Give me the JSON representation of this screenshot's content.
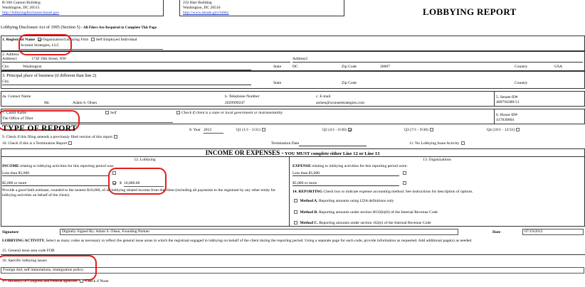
{
  "header": {
    "house_addr1": "B-106 Cannon Building",
    "house_addr2": "Washington, DC 20515",
    "house_link": "http://lobbyingdisclosure.house.gov",
    "senate_addr1": "232 Hart Building",
    "senate_addr2": "Washington, DC 20510",
    "senate_link": "http://www.senate.gov/lobby",
    "report_title": "LOBBYING REPORT"
  },
  "act_line": {
    "title": "Lobbying Disclosure Act of 1995 (Section 5)",
    "note": "- All Filers Are Required to Complete This Page"
  },
  "registrant": {
    "label_num": "1.",
    "label": "Registrant Name",
    "opt1": "Organization/Lobbying Firm",
    "opt2": "Self Employed Individual",
    "name": "Sconset Strategies, LLC"
  },
  "address": {
    "label": "2. Address",
    "addr1_label": "Address1",
    "addr1": "1730 19th Street, NW",
    "addr2_label": "Address2",
    "city_label": "City",
    "city": "Washington",
    "state_label": "State",
    "state": "DC",
    "zip_label": "Zip Code",
    "zip": "20007",
    "country_label": "Country",
    "country": "USA"
  },
  "principal": {
    "label": "3. Principal place of business (if different than line 2)",
    "city_label": "City",
    "state_label": "State",
    "zip_label": "Zip Code",
    "country_label": "Country"
  },
  "contact": {
    "label": "4a. Contact Name",
    "title": "Mr.",
    "name": "Adam S. Olsen",
    "phone_label": "b. Telephone Number",
    "phone": "2029999247",
    "email_label": "c. E-mail",
    "email": "aolsen@sconsetstrategies.com",
    "senate_id_label": "5. Senate ID#",
    "senate_id": "400794388-51"
  },
  "client": {
    "label": "7. Client Name",
    "self_label": "Self",
    "gov_label": "Check if client is a state or local government or instrumentality",
    "name": "The Office of Tibet",
    "house_id_label": "6. House ID#",
    "house_id": "417830004"
  },
  "type_report": {
    "title": "TYPE OF REPORT",
    "year_label": "8. Year",
    "year": "2012",
    "q1": "Q1 (1/1 - 3/31)",
    "q2": "Q2 (4/1 - 6/30)",
    "q3": "Q3 (7/1 - 9/30)",
    "q4": "Q4 (10/1 - 12/31)",
    "line9": "9. Check if this filing amends a previously filed version of this report",
    "line10": "10. Check if this is a Termination Report",
    "termination_label": "Termination Date",
    "line11": "11. No Lobbying Issue Activity"
  },
  "income": {
    "heading": "INCOME OR EXPENSES -",
    "heading_note": "YOU MUST complete either Line 12 or Line 13",
    "l12_title": "12. Lobbying",
    "l13_title": "13. Organizations",
    "income_intro_bold": "INCOME",
    "income_intro": "relating to lobbying activities for this reporting period was:",
    "less_label": "Less than $5,000",
    "more_label": "$5,000 or more",
    "dollar": "$",
    "amount": "10,000.00",
    "estimate_text": "Provide a good faith estimate, rounded to the nearest $10,000, of all lobbying related income from the client (including all payments to the registrant by any other entity for lobbying activities on behalf of the client).",
    "expense_intro_bold": "EXPENSE",
    "expense_intro": "relating to lobbying activities for this reporting period were:",
    "exp_less_label": "Less than $5,000",
    "exp_more_label": "$5,000 or more",
    "line14_bold": "14. REPORTING",
    "line14": "Check box to indicate expense accounting method. See instructions for description of options.",
    "method_a_bold": "Method A.",
    "method_a": "Reporting amounts using LDA definitions only",
    "method_b_bold": "Method B.",
    "method_b": "Reporting amounts under section 6033(b)(8) of the Internal Revenue Code",
    "method_c_bold": "Method C.",
    "method_c": "Reporting amounts under section 162(e) of the Internal Revenue Code"
  },
  "signature": {
    "label": "Signature",
    "value": "Digitally Signed By: Adam S. Olsen, Founding Partner",
    "date_label": "Date",
    "date": "07/19/2012"
  },
  "lobbying_activity": {
    "title": "LOBBYING ACTIVITY.",
    "text": "Select as many codes as necessary to reflect the general issue areas in which the registrant engaged in lobbying on behalf of the client during the reporting period. Using a separate page for each code, provide information as requested. Add additional page(s) as needed.",
    "line15": "15. General issue area code FOR",
    "line16": "16. Specific lobbying issues",
    "issues": "Foreign Aid, self immolations, immigration policy.",
    "line17": "17. House(s) of Congress and Federal agencies",
    "check_none": "Check if None"
  }
}
